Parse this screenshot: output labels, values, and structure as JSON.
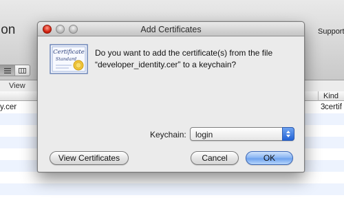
{
  "background_window": {
    "title_fragment": "ion",
    "toolbar_support_label": "Support",
    "view_label": "View",
    "table": {
      "kind_header": "Kind",
      "first_row": {
        "name": "y.cer",
        "col3": "3",
        "kind": "certif"
      }
    }
  },
  "dialog": {
    "title": "Add Certificates",
    "icon_text_line1": "Certificate",
    "icon_text_line2": "Standard",
    "message_line1": "Do you want to add the certificate(s) from the file",
    "message_line2": "“developer_identity.cer” to a keychain?",
    "keychain_label": "Keychain:",
    "keychain_value": "login",
    "buttons": {
      "view_certificates": "View Certificates",
      "cancel": "Cancel",
      "ok": "OK"
    }
  },
  "colors": {
    "default_button": "#6ea2ee",
    "close_button": "#d3210f",
    "row_alt": "#edf3fe",
    "popup_arrows": "#2162d6"
  },
  "icons": [
    "close-icon",
    "minimize-icon",
    "zoom-icon",
    "certificate-icon",
    "chevron-updown-icon",
    "list-view-icon",
    "column-view-icon"
  ]
}
